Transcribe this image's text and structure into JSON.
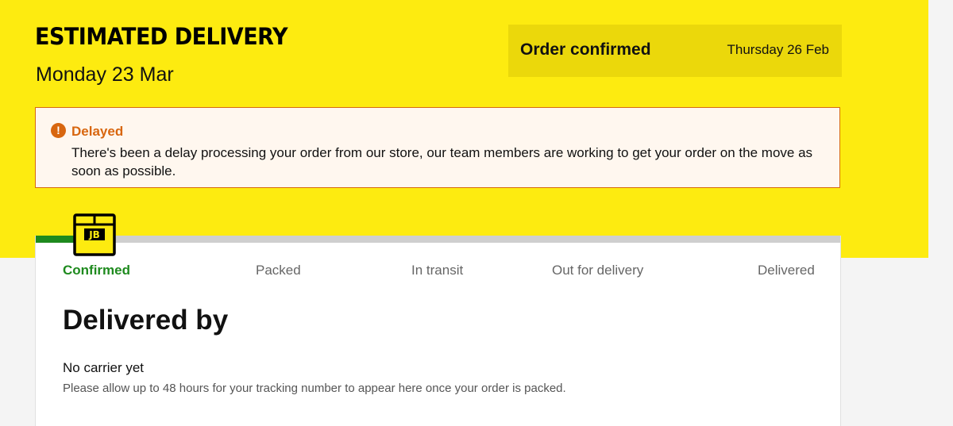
{
  "colors": {
    "band": "#fdeb10",
    "order_box": "#ebd80b",
    "alert_accent": "#d8660f",
    "alert_bg": "#fff7ef",
    "progress_done": "#1e8a1e",
    "progress_track": "#cfcfcf"
  },
  "header": {
    "title": "ESTIMATED DELIVERY",
    "date": "Monday 23 Mar"
  },
  "order_status": {
    "label": "Order confirmed",
    "date": "Thursday 26 Feb"
  },
  "alert": {
    "icon": "exclamation-circle-icon",
    "title": "Delayed",
    "message": "There's been a delay processing your order from our store, our team members are working to get your order on the move as soon as possible."
  },
  "tracker": {
    "icon": "package-box-icon",
    "badge": "JB",
    "progress": 0.05,
    "steps": [
      {
        "label": "Confirmed",
        "active": true
      },
      {
        "label": "Packed",
        "active": false
      },
      {
        "label": "In transit",
        "active": false
      },
      {
        "label": "Out for delivery",
        "active": false
      },
      {
        "label": "Delivered",
        "active": false
      }
    ]
  },
  "delivery": {
    "heading": "Delivered by",
    "carrier": "No carrier yet",
    "note": "Please allow up to 48 hours for your tracking number to appear here once your order is packed."
  }
}
